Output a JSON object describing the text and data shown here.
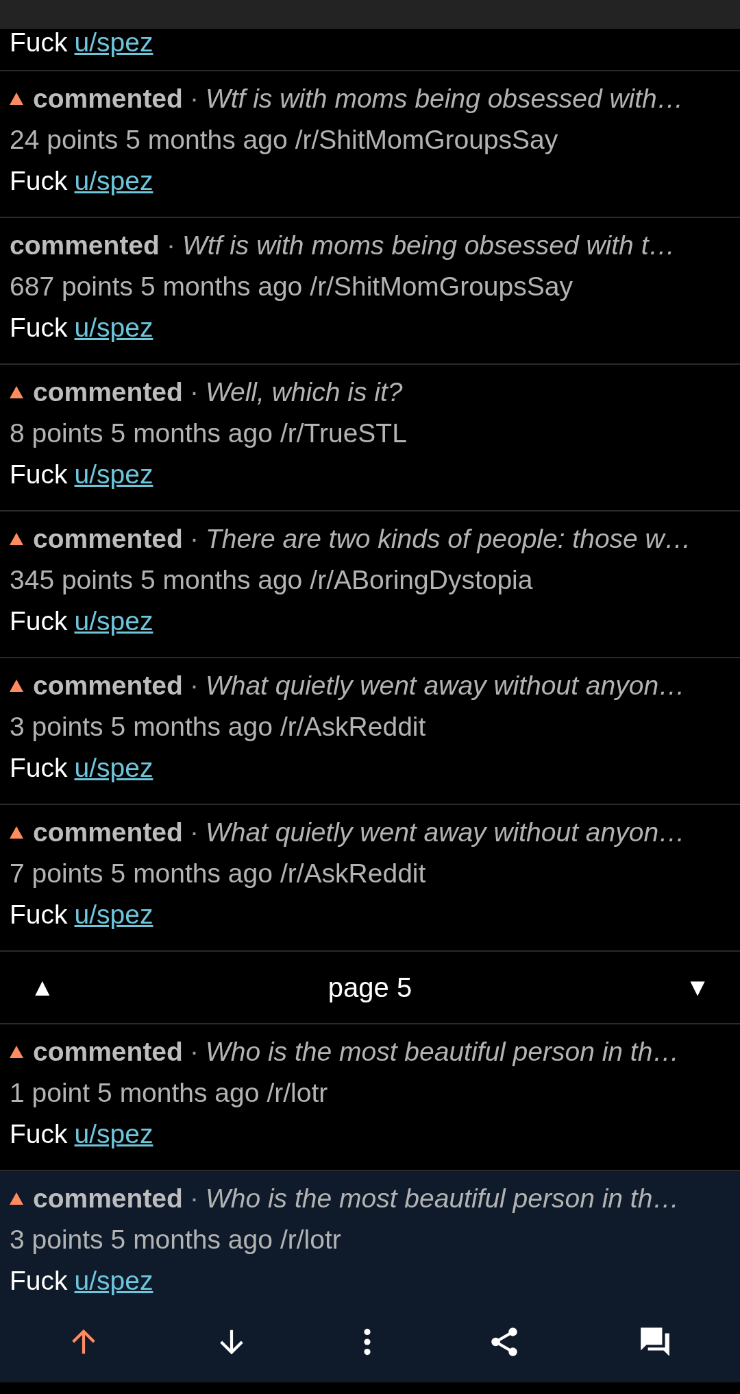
{
  "top_partial": {
    "body": {
      "text": "Fuck",
      "link": "u/spez"
    }
  },
  "items": [
    {
      "upvoted": true,
      "selected": false,
      "action": "commented",
      "sep": "·",
      "title": "Wtf is with moms being obsessed with…",
      "points": "24 points",
      "age": "5 months ago",
      "subreddit": "/r/ShitMomGroupsSay",
      "body": {
        "text": "Fuck",
        "link": "u/spez"
      }
    },
    {
      "upvoted": false,
      "selected": false,
      "action": "commented",
      "sep": "·",
      "title": "Wtf is with moms being obsessed with t…",
      "points": "687 points",
      "age": "5 months ago",
      "subreddit": "/r/ShitMomGroupsSay",
      "body": {
        "text": "Fuck",
        "link": "u/spez"
      }
    },
    {
      "upvoted": true,
      "selected": false,
      "action": "commented",
      "sep": "·",
      "title": "Well, which is it?",
      "points": "8 points",
      "age": "5 months ago",
      "subreddit": "/r/TrueSTL",
      "body": {
        "text": "Fuck",
        "link": "u/spez"
      }
    },
    {
      "upvoted": true,
      "selected": false,
      "action": "commented",
      "sep": "·",
      "title": "There are two kinds of people: those w…",
      "points": "345 points",
      "age": "5 months ago",
      "subreddit": "/r/ABoringDystopia",
      "body": {
        "text": "Fuck",
        "link": "u/spez"
      }
    },
    {
      "upvoted": true,
      "selected": false,
      "action": "commented",
      "sep": "·",
      "title": "What quietly went away without anyon…",
      "points": "3 points",
      "age": "5 months ago",
      "subreddit": "/r/AskReddit",
      "body": {
        "text": "Fuck",
        "link": "u/spez"
      }
    },
    {
      "upvoted": true,
      "selected": false,
      "action": "commented",
      "sep": "·",
      "title": "What quietly went away without anyon…",
      "points": "7 points",
      "age": "5 months ago",
      "subreddit": "/r/AskReddit",
      "body": {
        "text": "Fuck",
        "link": "u/spez"
      }
    }
  ],
  "pager": {
    "prev": "▲",
    "label": "page 5",
    "next": "▼"
  },
  "items_after": [
    {
      "upvoted": true,
      "selected": false,
      "action": "commented",
      "sep": "·",
      "title": "Who is the most beautiful person in th…",
      "points": "1 point",
      "age": "5 months ago",
      "subreddit": "/r/lotr",
      "body": {
        "text": "Fuck",
        "link": "u/spez"
      }
    },
    {
      "upvoted": true,
      "selected": true,
      "action": "commented",
      "sep": "·",
      "title": "Who is the most beautiful person in th…",
      "points": "3 points",
      "age": "5 months ago",
      "subreddit": "/r/lotr",
      "body": {
        "text": "Fuck",
        "link": "u/spez"
      },
      "actions": {
        "upvoted": true
      }
    }
  ]
}
